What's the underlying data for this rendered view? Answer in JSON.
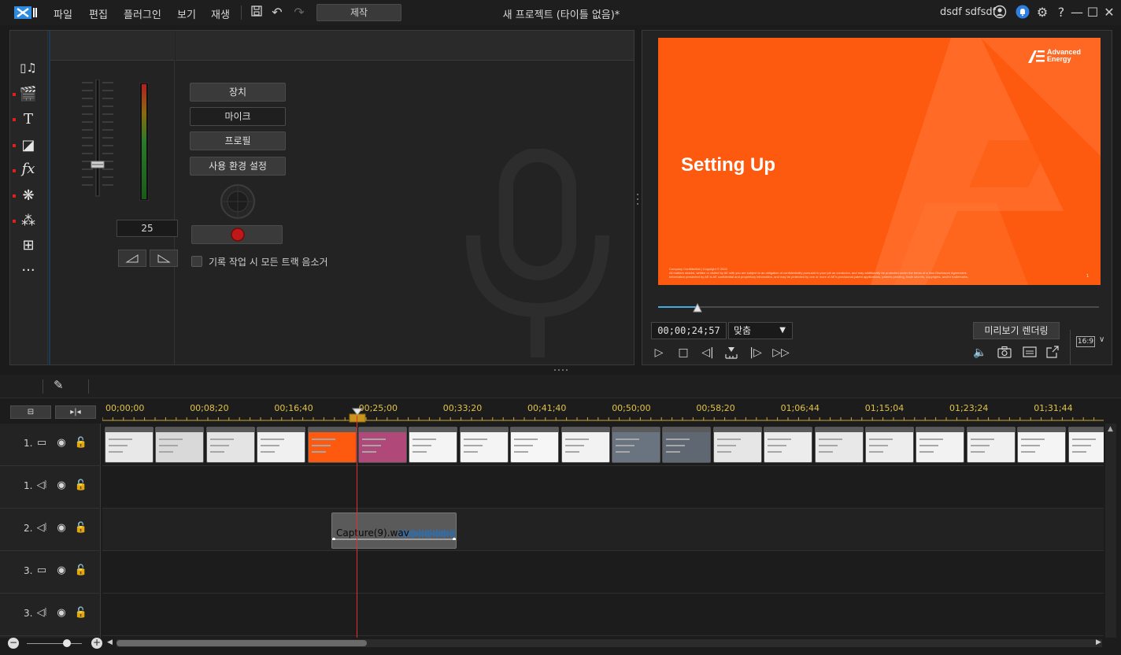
{
  "menu": {
    "file": "파일",
    "edit": "편집",
    "plugins": "플러그인",
    "view": "보기",
    "playback": "재생",
    "produce": "제작"
  },
  "window": {
    "title": "새 프로젝트 (타이틀 없음)*",
    "user": "dsdf sdfsdf"
  },
  "recorder": {
    "volume_value": "25",
    "device_label": "장치",
    "mic_label": "마이크",
    "profile_label": "프로필",
    "preferences_label": "사용 환경 설정",
    "mute_all_label": "기록 작업 시 모든 트랙 음소거",
    "mute_all_checked": false
  },
  "preview": {
    "slide_title": "Setting Up",
    "brand_line1": "Advanced",
    "brand_line2": "Energy",
    "fine_print": [
      "Company Confidential | Copyright © 2022",
      "All matters shared, written or visited by AE with you are subject to an obligation of confidentiality pursuant to your job as conductor, and may additionally be protected under the terms of a Non-Disclosure Agreement.",
      "Information presented by AE is AE confidential and proprietary information, and may be protected by one or more of AE's provisional patent applications, patents pending, trade secrets, copyrights, and/or trademarks."
    ],
    "page_number": "1",
    "timecode": "00;00;24;57",
    "zoom_option": "맞춤",
    "render_label": "미리보기 렌더링",
    "aspect_ratio": "16:9",
    "seek_progress": 0.09
  },
  "timeline": {
    "ruler_labels": [
      "00;00;00",
      "00;08;20",
      "00;16;40",
      "00;25;00",
      "00;33;20",
      "00;41;40",
      "00;50;00",
      "00;58;20",
      "01;06;44",
      "01;15;04",
      "01;23;24",
      "01;31;44"
    ],
    "tracks": [
      {
        "num": "1.",
        "kind": "video"
      },
      {
        "num": "1.",
        "kind": "audio"
      },
      {
        "num": "2.",
        "kind": "audio"
      },
      {
        "num": "3.",
        "kind": "video"
      },
      {
        "num": "3.",
        "kind": "audio"
      }
    ],
    "audio_clip_name": "Capture(9).wav",
    "video_clip_count": 20
  },
  "colors": {
    "accent_orange": "#fe5a0f",
    "playhead_red": "#e03030",
    "ruler_gold": "#e0c24a",
    "seek_blue": "#49a8e0"
  }
}
